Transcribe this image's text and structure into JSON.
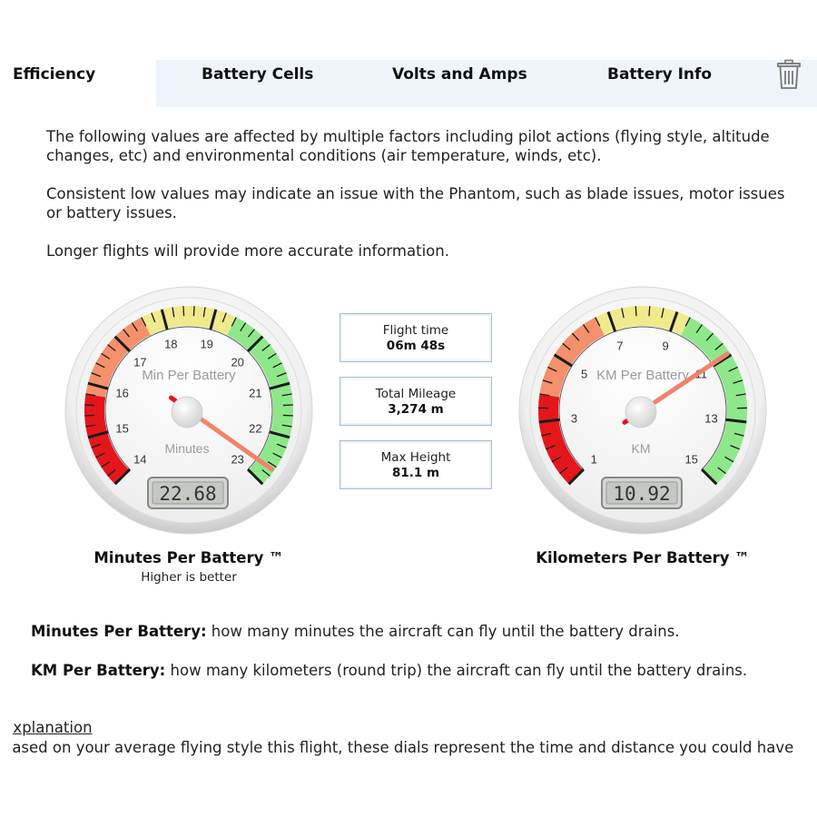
{
  "tabs": [
    {
      "label": "Efficiency"
    },
    {
      "label": "Battery Cells"
    },
    {
      "label": "Volts and Amps"
    },
    {
      "label": "Battery Info"
    }
  ],
  "intro": {
    "p1": "The following values are affected by multiple factors including pilot actions (flying style, altitude changes, etc) and environmental conditions (air temperature, winds, etc).",
    "p2": "Consistent low values may indicate an issue with the Phantom, such as blade issues, motor issues or battery issues.",
    "p3": "Longer flights will provide more accurate information."
  },
  "gauges": {
    "minutes": {
      "title": "Min Per Battery",
      "unit": "Minutes",
      "min": 14,
      "max": 23,
      "ticks": [
        "14",
        "15",
        "16",
        "17",
        "18",
        "19",
        "20",
        "21",
        "22",
        "23"
      ],
      "value": 22.68,
      "display": "22.68",
      "caption": "Minutes Per Battery ™",
      "subcaption": "Higher is better"
    },
    "km": {
      "title": "KM Per Battery",
      "unit": "KM",
      "min": 1,
      "max": 15,
      "ticks": [
        "1",
        "3",
        "5",
        "7",
        "9",
        "11",
        "13",
        "15"
      ],
      "value": 10.92,
      "display": "10.92",
      "caption": "Kilometers Per Battery ™"
    }
  },
  "stats": {
    "flight_time": {
      "label": "Flight time",
      "value": "06m 48s"
    },
    "mileage": {
      "label": "Total Mileage",
      "value": "3,274 m"
    },
    "max_height": {
      "label": "Max Height",
      "value": "81.1 m"
    }
  },
  "definitions": {
    "min_term": "Minutes Per Battery:",
    "min_text": " how many minutes the aircraft can fly until the battery drains.",
    "km_term": "KM Per Battery:",
    "km_text": " how many kilometers (round trip) the aircraft can fly until the battery drains."
  },
  "explanation": {
    "title": "Explanation",
    "text": "Based on your average flying style this flight, these dials represent the time and distance you could have"
  },
  "colors": {
    "red": "#e4161b",
    "salmon": "#f4906c",
    "yellow": "#f0ea8c",
    "green": "#8ee88a",
    "needle": "#f0836a",
    "tab_bg": "#eef4fa"
  }
}
